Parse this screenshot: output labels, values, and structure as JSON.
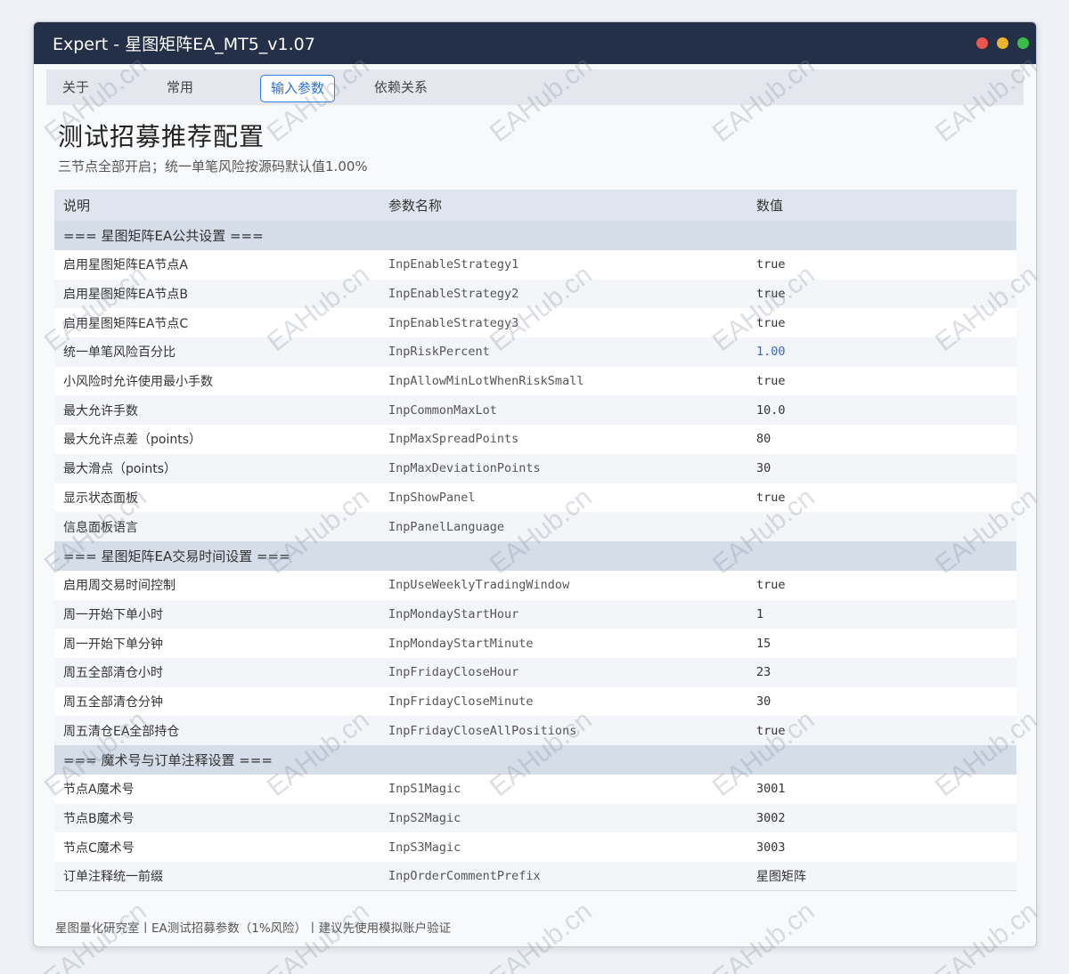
{
  "window": {
    "title": "Expert - 星图矩阵EA_MT5_v1.07",
    "controls": {
      "close_color": "#e9574e",
      "minimize_color": "#e8b52f",
      "maximize_color": "#3bbd4b"
    }
  },
  "tabs": [
    {
      "label": "关于"
    },
    {
      "label": "常用"
    },
    {
      "label": "输入参数"
    },
    {
      "label": "依赖关系"
    }
  ],
  "heading": {
    "title": "测试招募推荐配置",
    "subtitle": "三节点全部开启；统一单笔风险按源码默认值1.00%"
  },
  "table": {
    "headers": [
      "说明",
      "参数名称",
      "数值"
    ],
    "rows": [
      {
        "section": "=== 星图矩阵EA公共设置 ==="
      },
      {
        "desc": "启用星图矩阵EA节点A",
        "name": "InpEnableStrategy1",
        "value": "true"
      },
      {
        "desc": "启用星图矩阵EA节点B",
        "name": "InpEnableStrategy2",
        "value": "true"
      },
      {
        "desc": "启用星图矩阵EA节点C",
        "name": "InpEnableStrategy3",
        "value": "true"
      },
      {
        "desc": "统一单笔风险百分比",
        "name": "InpRiskPercent",
        "value": "1.00",
        "highlight": true
      },
      {
        "desc": "小风险时允许使用最小手数",
        "name": "InpAllowMinLotWhenRiskSmall",
        "value": "true"
      },
      {
        "desc": "最大允许手数",
        "name": "InpCommonMaxLot",
        "value": "10.0"
      },
      {
        "desc": "最大允许点差（points）",
        "name": "InpMaxSpreadPoints",
        "value": "80"
      },
      {
        "desc": "最大滑点（points）",
        "name": "InpMaxDeviationPoints",
        "value": "30"
      },
      {
        "desc": "显示状态面板",
        "name": "InpShowPanel",
        "value": "true"
      },
      {
        "desc": "信息面板语言",
        "name": "InpPanelLanguage",
        "value": ""
      },
      {
        "section": "=== 星图矩阵EA交易时间设置 ==="
      },
      {
        "desc": "启用周交易时间控制",
        "name": "InpUseWeeklyTradingWindow",
        "value": "true"
      },
      {
        "desc": "周一开始下单小时",
        "name": "InpMondayStartHour",
        "value": "1"
      },
      {
        "desc": "周一开始下单分钟",
        "name": "InpMondayStartMinute",
        "value": "15"
      },
      {
        "desc": "周五全部清仓小时",
        "name": "InpFridayCloseHour",
        "value": "23"
      },
      {
        "desc": "周五全部清仓分钟",
        "name": "InpFridayCloseMinute",
        "value": "30"
      },
      {
        "desc": "周五清仓EA全部持仓",
        "name": "InpFridayCloseAllPositions",
        "value": "true"
      },
      {
        "section": "=== 魔术号与订单注释设置 ==="
      },
      {
        "desc": "节点A魔术号",
        "name": "InpS1Magic",
        "value": "3001"
      },
      {
        "desc": "节点B魔术号",
        "name": "InpS2Magic",
        "value": "3002"
      },
      {
        "desc": "节点C魔术号",
        "name": "InpS3Magic",
        "value": "3003"
      },
      {
        "desc": "订单注释统一前缀",
        "name": "InpOrderCommentPrefix",
        "value": "星图矩阵",
        "cjk": true
      }
    ]
  },
  "footer": {
    "text": "星图量化研究室丨EA测试招募参数（1%风险）丨建议先使用模拟账户验证"
  },
  "watermark": {
    "text": "EAHub.cn"
  }
}
